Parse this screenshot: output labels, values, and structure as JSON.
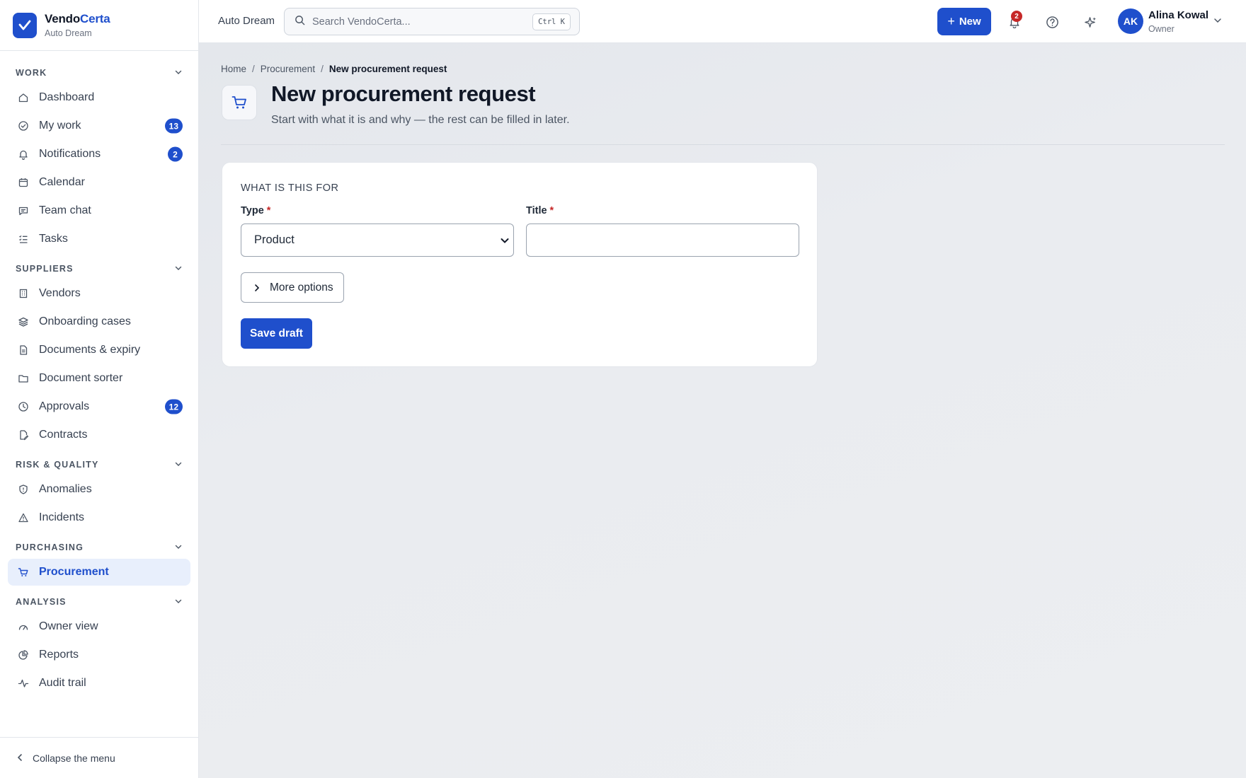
{
  "brand": {
    "name_main": "Vendo",
    "name_accent": "Certa",
    "org": "Auto Dream"
  },
  "sidebar": {
    "sections": [
      {
        "title": "WORK",
        "items": [
          {
            "label": "Dashboard",
            "icon": "home-icon"
          },
          {
            "label": "My work",
            "icon": "check-circle-icon",
            "badge": "13"
          },
          {
            "label": "Notifications",
            "icon": "bell-icon",
            "badge": "2"
          },
          {
            "label": "Calendar",
            "icon": "calendar-icon"
          },
          {
            "label": "Team chat",
            "icon": "chat-icon"
          },
          {
            "label": "Tasks",
            "icon": "list-check-icon"
          }
        ]
      },
      {
        "title": "SUPPLIERS",
        "items": [
          {
            "label": "Vendors",
            "icon": "building-icon"
          },
          {
            "label": "Onboarding cases",
            "icon": "layers-icon"
          },
          {
            "label": "Documents & expiry",
            "icon": "document-icon"
          },
          {
            "label": "Document sorter",
            "icon": "folder-icon"
          },
          {
            "label": "Approvals",
            "icon": "clock-icon",
            "badge": "12"
          },
          {
            "label": "Contracts",
            "icon": "contract-icon"
          }
        ]
      },
      {
        "title": "RISK & QUALITY",
        "items": [
          {
            "label": "Anomalies",
            "icon": "shield-icon"
          },
          {
            "label": "Incidents",
            "icon": "warning-icon"
          }
        ]
      },
      {
        "title": "PURCHASING",
        "items": [
          {
            "label": "Procurement",
            "icon": "cart-icon",
            "active": true
          }
        ]
      },
      {
        "title": "ANALYSIS",
        "items": [
          {
            "label": "Owner view",
            "icon": "gauge-icon"
          },
          {
            "label": "Reports",
            "icon": "pie-chart-icon"
          },
          {
            "label": "Audit trail",
            "icon": "activity-icon"
          }
        ]
      }
    ],
    "collapse_label": "Collapse the menu"
  },
  "topbar": {
    "org_label": "Auto Dream",
    "search_placeholder": "Search VendoCerta...",
    "search_shortcut": "Ctrl K",
    "new_label": "New",
    "notification_count": "2",
    "user": {
      "initials": "AK",
      "name": "Alina Kowal",
      "role": "Owner"
    }
  },
  "breadcrumb": [
    "Home",
    "Procurement",
    "New procurement request"
  ],
  "page": {
    "title": "New procurement request",
    "subtitle": "Start with what it is and why — the rest can be filled in later."
  },
  "form": {
    "section_title": "WHAT IS THIS FOR",
    "type_label": "Type",
    "type_value": "Product",
    "title_label": "Title",
    "title_value": "",
    "more_options_label": "More options",
    "save_label": "Save draft"
  },
  "colors": {
    "accent": "#1f4fcc",
    "danger": "#c62828",
    "active_bg": "#e8effc"
  }
}
